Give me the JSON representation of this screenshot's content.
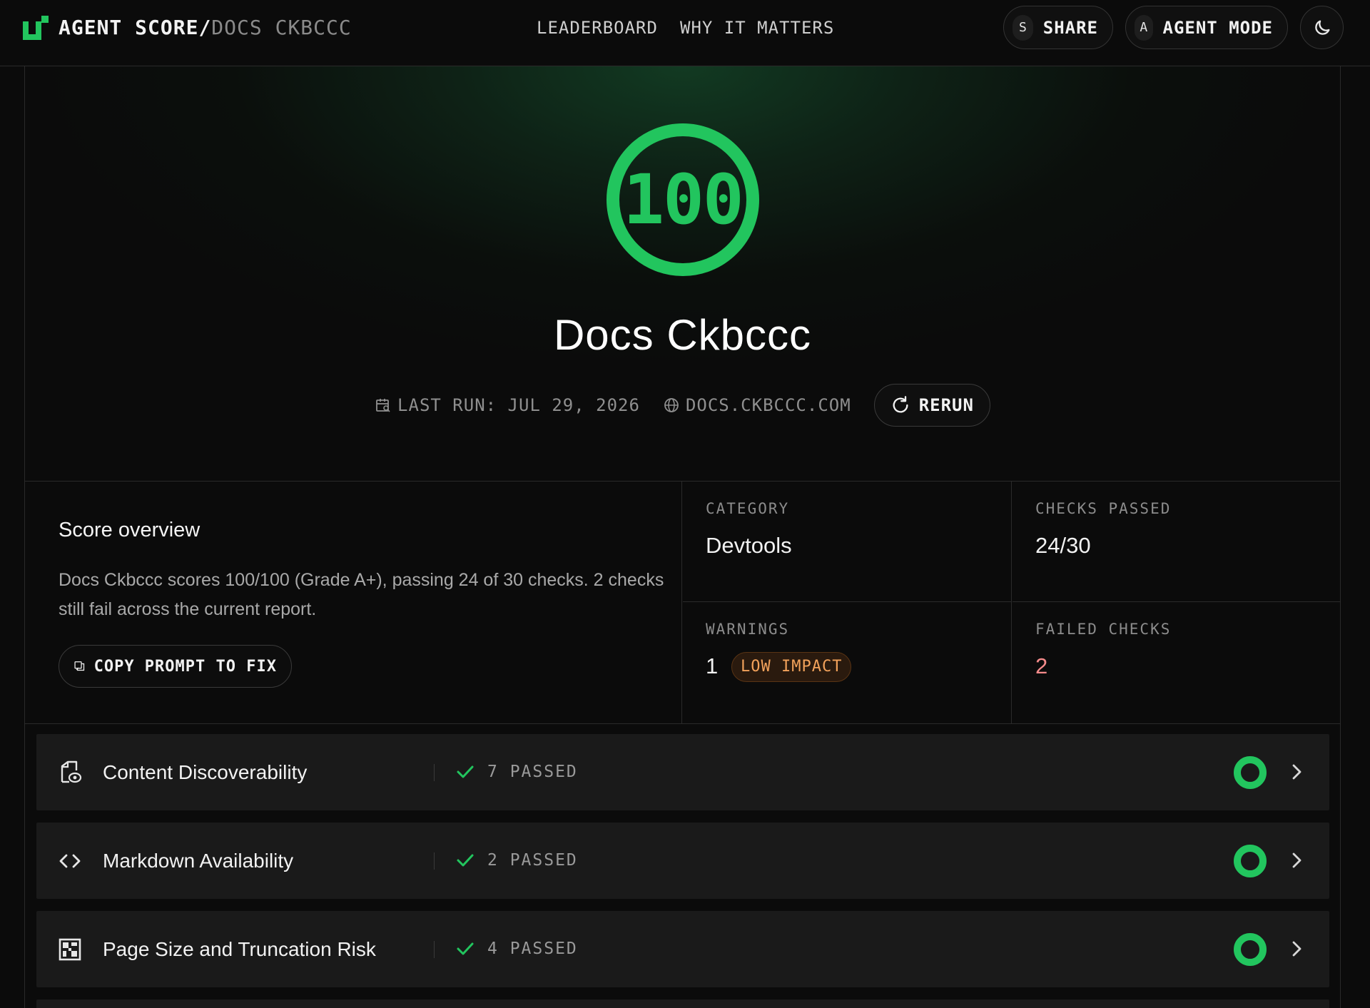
{
  "header": {
    "brand_primary": "AGENT SCORE",
    "brand_separator": "/",
    "brand_secondary": "DOCS CKBCCC",
    "nav": [
      {
        "label": "LEADERBOARD"
      },
      {
        "label": "WHY IT MATTERS"
      }
    ],
    "share": {
      "key": "S",
      "label": "SHARE"
    },
    "agent_mode": {
      "key": "A",
      "label": "AGENT MODE"
    },
    "theme_icon": "moon-icon"
  },
  "hero": {
    "score": "100",
    "title": "Docs Ckbccc",
    "last_run": "LAST RUN: JUL 29, 2026",
    "domain": "DOCS.CKBCCC.COM",
    "rerun_label": "RERUN"
  },
  "overview": {
    "title": "Score overview",
    "description": "Docs Ckbccc scores 100/100 (Grade A+), passing 24 of 30 checks. 2 checks still fail across the current report.",
    "copy_prompt_label": "COPY PROMPT TO FIX",
    "stats": {
      "category": {
        "label": "CATEGORY",
        "value": "Devtools"
      },
      "checks_passed": {
        "label": "CHECKS PASSED",
        "value": "24/30"
      },
      "warnings": {
        "label": "WARNINGS",
        "value": "1",
        "badge": "LOW IMPACT"
      },
      "failed_checks": {
        "label": "FAILED CHECKS",
        "value": "2"
      }
    }
  },
  "categories": [
    {
      "name": "Content Discoverability",
      "passed": "7 PASSED",
      "icon": "document-eye-icon"
    },
    {
      "name": "Markdown Availability",
      "passed": "2 PASSED",
      "icon": "code-brackets-icon"
    },
    {
      "name": "Page Size and Truncation Risk",
      "passed": "4 PASSED",
      "icon": "layout-grid-icon"
    }
  ],
  "colors": {
    "accent_green": "#22c55e",
    "warning_orange": "#f2a25b",
    "fail_red": "#f58b8b",
    "background": "#0b0b0b"
  }
}
